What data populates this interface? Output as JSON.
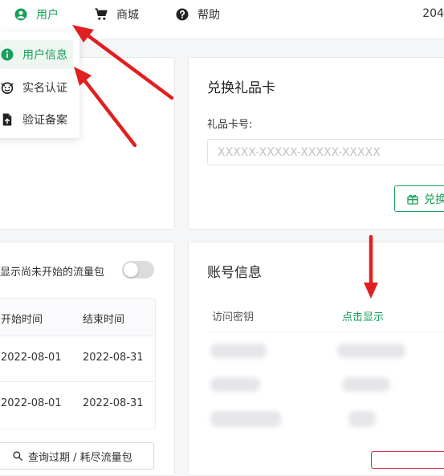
{
  "nav": {
    "user": "用户",
    "shop": "商城",
    "help": "帮助",
    "right_text": "204"
  },
  "dropdown": {
    "items": [
      "用户信息",
      "实名认证",
      "验证备案"
    ]
  },
  "gift_card": {
    "title": "兑换礼品卡",
    "label": "礼品卡号:",
    "placeholder": "XXXXX-XXXXX-XXXXX-XXXXX",
    "button": "兑换"
  },
  "traffic": {
    "toggle_label": "显示尚未开始的流量包",
    "columns": [
      "开始时间",
      "结束时间"
    ],
    "rows": [
      [
        "2022-08-01",
        "2022-08-31"
      ],
      [
        "2022-08-01",
        "2022-08-31"
      ]
    ],
    "query_button": "查询过期 / 耗尽流量包"
  },
  "account": {
    "title": "账号信息",
    "key_label": "访问密钥",
    "key_action": "点击显示"
  },
  "colors": {
    "accent": "#18a058",
    "danger": "#d03050",
    "annotation": "#e02020"
  },
  "icons": {
    "user": "user-circle-icon",
    "shop": "cart-icon",
    "help": "help-circle-icon",
    "info": "info-circle-icon",
    "verify": "face-icon",
    "record": "file-upload-icon",
    "gift": "gift-icon",
    "search": "search-icon"
  }
}
